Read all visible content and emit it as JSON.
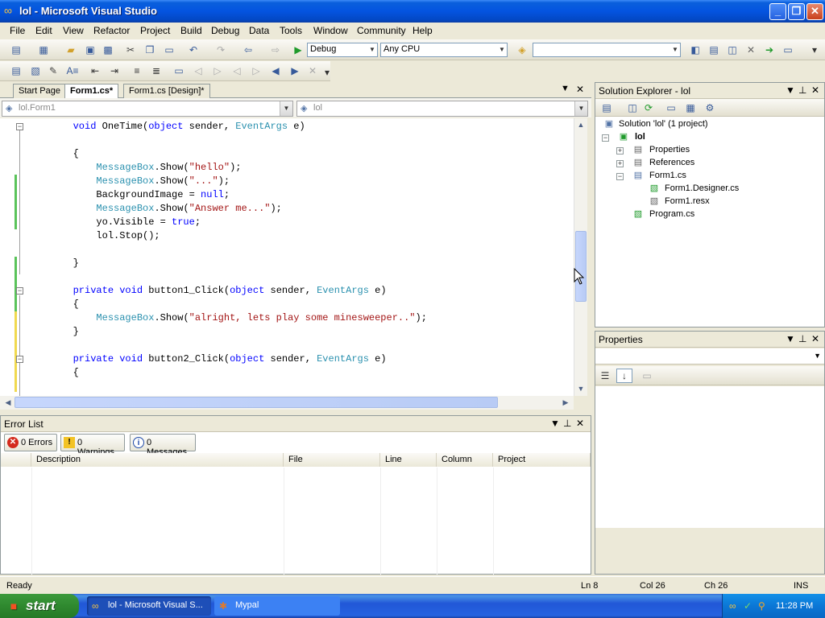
{
  "window": {
    "title": "lol - Microsoft Visual Studio",
    "controls": {
      "minimize": "_",
      "maximize": "❐",
      "close": "✕"
    }
  },
  "menu": [
    "File",
    "Edit",
    "View",
    "Refactor",
    "Project",
    "Build",
    "Debug",
    "Data",
    "Tools",
    "Window",
    "Community",
    "Help"
  ],
  "toolbar": {
    "config": "Debug",
    "platform": "Any CPU",
    "find_value": ""
  },
  "tabs": [
    "Start Page",
    "Form1.cs*",
    "Form1.cs [Design]*"
  ],
  "active_tab": "Form1.cs*",
  "nav": {
    "type_combo": "lol.Form1",
    "member_combo": "lol"
  },
  "editor": {
    "lines": [
      [
        {
          "t": "        "
        },
        {
          "t": "void",
          "c": "kw"
        },
        {
          "t": " OneTime("
        },
        {
          "t": "object",
          "c": "kw"
        },
        {
          "t": " sender, "
        },
        {
          "t": "EventArgs",
          "c": "ty"
        },
        {
          "t": " e)"
        }
      ],
      [],
      [
        {
          "t": "        {"
        }
      ],
      [
        {
          "t": "            "
        },
        {
          "t": "MessageBox",
          "c": "ty"
        },
        {
          "t": ".Show("
        },
        {
          "t": "\"hello\"",
          "c": "st"
        },
        {
          "t": ");"
        }
      ],
      [
        {
          "t": "            "
        },
        {
          "t": "MessageBox",
          "c": "ty"
        },
        {
          "t": ".Show("
        },
        {
          "t": "\"...\"",
          "c": "st"
        },
        {
          "t": ");"
        }
      ],
      [
        {
          "t": "            BackgroundImage = "
        },
        {
          "t": "null",
          "c": "kw"
        },
        {
          "t": ";"
        }
      ],
      [
        {
          "t": "            "
        },
        {
          "t": "MessageBox",
          "c": "ty"
        },
        {
          "t": ".Show("
        },
        {
          "t": "\"Answer me...\"",
          "c": "st"
        },
        {
          "t": ");"
        }
      ],
      [
        {
          "t": "            yo.Visible = "
        },
        {
          "t": "true",
          "c": "kw"
        },
        {
          "t": ";"
        }
      ],
      [
        {
          "t": "            lol.Stop();"
        }
      ],
      [],
      [
        {
          "t": "        }"
        }
      ],
      [],
      [
        {
          "t": "        "
        },
        {
          "t": "private",
          "c": "kw"
        },
        {
          "t": " "
        },
        {
          "t": "void",
          "c": "kw"
        },
        {
          "t": " button1_Click("
        },
        {
          "t": "object",
          "c": "kw"
        },
        {
          "t": " sender, "
        },
        {
          "t": "EventArgs",
          "c": "ty"
        },
        {
          "t": " e)"
        }
      ],
      [
        {
          "t": "        {"
        }
      ],
      [
        {
          "t": "            "
        },
        {
          "t": "MessageBox",
          "c": "ty"
        },
        {
          "t": ".Show("
        },
        {
          "t": "\"alright, lets play some minesweeper..\"",
          "c": "st"
        },
        {
          "t": ");"
        }
      ],
      [
        {
          "t": "        }"
        }
      ],
      [],
      [
        {
          "t": "        "
        },
        {
          "t": "private",
          "c": "kw"
        },
        {
          "t": " "
        },
        {
          "t": "void",
          "c": "kw"
        },
        {
          "t": " button2_Click("
        },
        {
          "t": "object",
          "c": "kw"
        },
        {
          "t": " sender, "
        },
        {
          "t": "EventArgs",
          "c": "ty"
        },
        {
          "t": " e)"
        }
      ],
      [
        {
          "t": "        {"
        }
      ]
    ]
  },
  "error_list": {
    "title": "Error List",
    "errors": "0 Errors",
    "warnings": "0 Warnings",
    "messages": "0 Messages",
    "columns": [
      "Description",
      "File",
      "Line",
      "Column",
      "Project"
    ]
  },
  "solution_explorer": {
    "title": "Solution Explorer - lol",
    "solution": "Solution 'lol' (1 project)",
    "project": "lol",
    "items": [
      "Properties",
      "References",
      "Form1.cs",
      "Form1.Designer.cs",
      "Form1.resx",
      "Program.cs"
    ]
  },
  "properties": {
    "title": "Properties"
  },
  "status": {
    "text": "Ready",
    "ln": "Ln 8",
    "col": "Col 26",
    "ch": "Ch 26",
    "mode": "INS"
  },
  "taskbar": {
    "start": "start",
    "tasks": [
      "lol - Microsoft Visual S...",
      "Mypal"
    ],
    "clock": "11:28 PM"
  }
}
